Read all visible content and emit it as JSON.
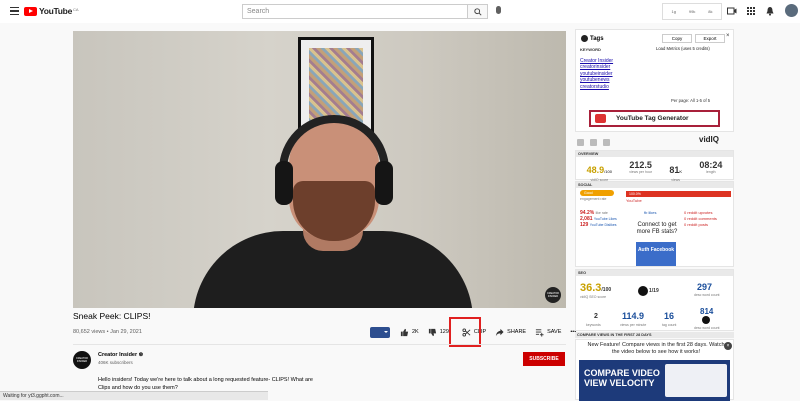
{
  "header": {
    "logo_text": "YouTube",
    "logo_country": "CA",
    "search_placeholder": "Search",
    "vidiq_stats": [
      "1g",
      "99k",
      "8k"
    ]
  },
  "video": {
    "watermark": "CREATOR INSIDER",
    "title": "Sneak Peek: CLIPS!",
    "meta": "80,652 views • Jan 29, 2021",
    "likes": "2K",
    "dislikes": "129",
    "clip_label": "CLIP",
    "share_label": "SHARE",
    "save_label": "SAVE",
    "more_label": "•••"
  },
  "channel": {
    "avatar_text": "CREATOR INSIDER",
    "name": "Creator Insider",
    "verified_mark": "⊛",
    "subscribers": "406K subscribers",
    "subscribe_label": "SUBSCRIBE",
    "description": "Hello insiders! Today we're here to talk about a long requested feature- CLIPS! What are Clips and how do you use them?"
  },
  "statusbar": {
    "text": "Waiting for yt3.ggpht.com..."
  },
  "tags_panel": {
    "title": "Tags",
    "copy_label": "Copy",
    "export_label": "Export",
    "close_label": "×",
    "keyword_header": "KEYWORD",
    "load_metrics": "Load Metrics (uses 5 credits)",
    "tags": [
      "Creator Insider",
      "creatorinsider",
      "youtubeinsider",
      "youtubenews",
      "creatorstudio"
    ],
    "per_page_label": "Per page:",
    "per_page_value": "All",
    "range": "1-5 of 5",
    "generator_label": "YouTube Tag Generator"
  },
  "vidiq": {
    "logo": "vidIQ"
  },
  "overview": {
    "header": "OVERVIEW",
    "score": "48.9",
    "score_max": "/100",
    "score_label": "vidIQ score",
    "views_per_hour": "212.5",
    "views_per_hour_label": "views per hour",
    "views": "81",
    "views_suffix": "K",
    "views_label": "views",
    "length": "08:24",
    "length_label": "length"
  },
  "social": {
    "header": "SOCIAL",
    "engagement_pill": "Good",
    "engagement_label": "engagement rate",
    "yt_bar": "100.0%",
    "yt_label": "YouTube",
    "like_rate": "94.2%",
    "like_rate_label": "like rate",
    "yt_likes": "2,081",
    "yt_likes_label": "YouTube Likes",
    "yt_dislikes": "129",
    "yt_dislikes_label": "YouTube Dislikes",
    "fb_likes": "fb likes",
    "reddit_upvotes": "0 reddit upvotes",
    "reddit_comments": "0 reddit comments",
    "reddit_posts": "0 reddit posts",
    "connect_text": "Connect to get more FB stats?",
    "auth_label": "Auth Facebook"
  },
  "seo": {
    "header": "SEO",
    "score": "36.3",
    "score_max": "/100",
    "score_label": "vidIQ SEO score",
    "rank_fraction": "1/19",
    "title_count": "297",
    "title_count_label": "desc word count",
    "keywords": "2",
    "keywords_label": "keywords",
    "views_per_min": "114.9",
    "views_per_min_label": "views per minute",
    "tag_count": "16",
    "tag_count_label": "tag count",
    "desc_count": "814",
    "desc_count_label": "desc word count"
  },
  "compare": {
    "header": "COMPARE VIEWS IN THE FIRST 28 DAYS",
    "message": "New Feature! Compare views in the first 28 days. Watch the video below to see how it works!",
    "close_label": "×",
    "thumb_text_1": "COMPARE VIDEO",
    "thumb_text_2": "VIEW VELOCITY"
  }
}
